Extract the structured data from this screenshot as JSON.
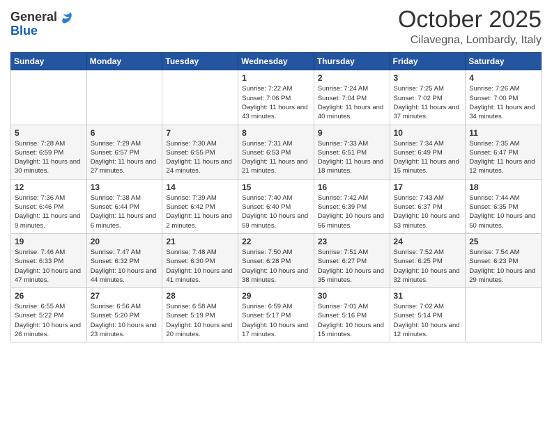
{
  "header": {
    "logo_line1": "General",
    "logo_line2": "Blue",
    "month": "October 2025",
    "location": "Cilavegna, Lombardy, Italy"
  },
  "days_of_week": [
    "Sunday",
    "Monday",
    "Tuesday",
    "Wednesday",
    "Thursday",
    "Friday",
    "Saturday"
  ],
  "weeks": [
    [
      {
        "day": "",
        "info": ""
      },
      {
        "day": "",
        "info": ""
      },
      {
        "day": "",
        "info": ""
      },
      {
        "day": "1",
        "info": "Sunrise: 7:22 AM\nSunset: 7:06 PM\nDaylight: 11 hours\nand 43 minutes."
      },
      {
        "day": "2",
        "info": "Sunrise: 7:24 AM\nSunset: 7:04 PM\nDaylight: 11 hours\nand 40 minutes."
      },
      {
        "day": "3",
        "info": "Sunrise: 7:25 AM\nSunset: 7:02 PM\nDaylight: 11 hours\nand 37 minutes."
      },
      {
        "day": "4",
        "info": "Sunrise: 7:26 AM\nSunset: 7:00 PM\nDaylight: 11 hours\nand 34 minutes."
      }
    ],
    [
      {
        "day": "5",
        "info": "Sunrise: 7:28 AM\nSunset: 6:59 PM\nDaylight: 11 hours\nand 30 minutes."
      },
      {
        "day": "6",
        "info": "Sunrise: 7:29 AM\nSunset: 6:57 PM\nDaylight: 11 hours\nand 27 minutes."
      },
      {
        "day": "7",
        "info": "Sunrise: 7:30 AM\nSunset: 6:55 PM\nDaylight: 11 hours\nand 24 minutes."
      },
      {
        "day": "8",
        "info": "Sunrise: 7:31 AM\nSunset: 6:53 PM\nDaylight: 11 hours\nand 21 minutes."
      },
      {
        "day": "9",
        "info": "Sunrise: 7:33 AM\nSunset: 6:51 PM\nDaylight: 11 hours\nand 18 minutes."
      },
      {
        "day": "10",
        "info": "Sunrise: 7:34 AM\nSunset: 6:49 PM\nDaylight: 11 hours\nand 15 minutes."
      },
      {
        "day": "11",
        "info": "Sunrise: 7:35 AM\nSunset: 6:47 PM\nDaylight: 11 hours\nand 12 minutes."
      }
    ],
    [
      {
        "day": "12",
        "info": "Sunrise: 7:36 AM\nSunset: 6:46 PM\nDaylight: 11 hours\nand 9 minutes."
      },
      {
        "day": "13",
        "info": "Sunrise: 7:38 AM\nSunset: 6:44 PM\nDaylight: 11 hours\nand 6 minutes."
      },
      {
        "day": "14",
        "info": "Sunrise: 7:39 AM\nSunset: 6:42 PM\nDaylight: 11 hours\nand 2 minutes."
      },
      {
        "day": "15",
        "info": "Sunrise: 7:40 AM\nSunset: 6:40 PM\nDaylight: 10 hours\nand 59 minutes."
      },
      {
        "day": "16",
        "info": "Sunrise: 7:42 AM\nSunset: 6:39 PM\nDaylight: 10 hours\nand 56 minutes."
      },
      {
        "day": "17",
        "info": "Sunrise: 7:43 AM\nSunset: 6:37 PM\nDaylight: 10 hours\nand 53 minutes."
      },
      {
        "day": "18",
        "info": "Sunrise: 7:44 AM\nSunset: 6:35 PM\nDaylight: 10 hours\nand 50 minutes."
      }
    ],
    [
      {
        "day": "19",
        "info": "Sunrise: 7:46 AM\nSunset: 6:33 PM\nDaylight: 10 hours\nand 47 minutes."
      },
      {
        "day": "20",
        "info": "Sunrise: 7:47 AM\nSunset: 6:32 PM\nDaylight: 10 hours\nand 44 minutes."
      },
      {
        "day": "21",
        "info": "Sunrise: 7:48 AM\nSunset: 6:30 PM\nDaylight: 10 hours\nand 41 minutes."
      },
      {
        "day": "22",
        "info": "Sunrise: 7:50 AM\nSunset: 6:28 PM\nDaylight: 10 hours\nand 38 minutes."
      },
      {
        "day": "23",
        "info": "Sunrise: 7:51 AM\nSunset: 6:27 PM\nDaylight: 10 hours\nand 35 minutes."
      },
      {
        "day": "24",
        "info": "Sunrise: 7:52 AM\nSunset: 6:25 PM\nDaylight: 10 hours\nand 32 minutes."
      },
      {
        "day": "25",
        "info": "Sunrise: 7:54 AM\nSunset: 6:23 PM\nDaylight: 10 hours\nand 29 minutes."
      }
    ],
    [
      {
        "day": "26",
        "info": "Sunrise: 6:55 AM\nSunset: 5:22 PM\nDaylight: 10 hours\nand 26 minutes."
      },
      {
        "day": "27",
        "info": "Sunrise: 6:56 AM\nSunset: 5:20 PM\nDaylight: 10 hours\nand 23 minutes."
      },
      {
        "day": "28",
        "info": "Sunrise: 6:58 AM\nSunset: 5:19 PM\nDaylight: 10 hours\nand 20 minutes."
      },
      {
        "day": "29",
        "info": "Sunrise: 6:59 AM\nSunset: 5:17 PM\nDaylight: 10 hours\nand 17 minutes."
      },
      {
        "day": "30",
        "info": "Sunrise: 7:01 AM\nSunset: 5:16 PM\nDaylight: 10 hours\nand 15 minutes."
      },
      {
        "day": "31",
        "info": "Sunrise: 7:02 AM\nSunset: 5:14 PM\nDaylight: 10 hours\nand 12 minutes."
      },
      {
        "day": "",
        "info": ""
      }
    ]
  ]
}
